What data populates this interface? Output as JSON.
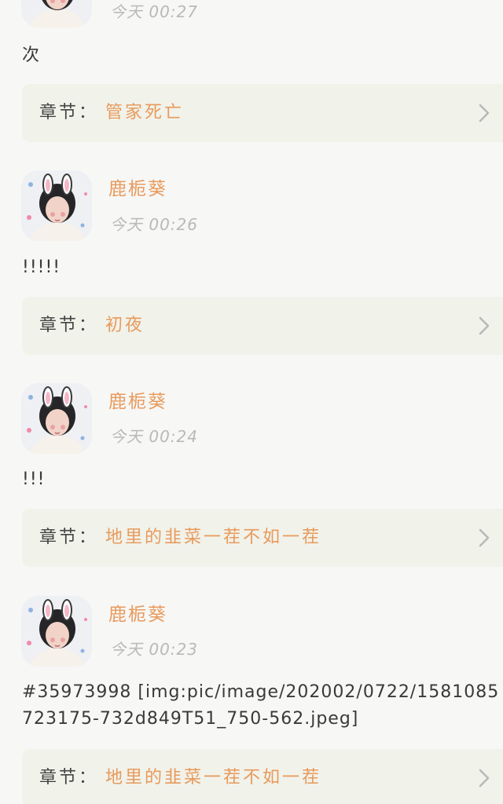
{
  "feed": {
    "entries": [
      {
        "username": "",
        "time": "今天 00:27",
        "content": "次",
        "chapter_prefix": "章节：",
        "chapter_title": "管家死亡"
      },
      {
        "username": "鹿栀葵",
        "time": "今天 00:26",
        "content": "!!!!!",
        "chapter_prefix": "章节：",
        "chapter_title": "初夜"
      },
      {
        "username": "鹿栀葵",
        "time": "今天 00:24",
        "content": "!!!",
        "chapter_prefix": "章节：",
        "chapter_title": "地里的韭菜一茬不如一茬"
      },
      {
        "username": "鹿栀葵",
        "time": "今天 00:23",
        "content": "#35973998 [img:pic/image/202002/0722/1581085723175-732d849T51_750-562.jpeg]",
        "chapter_prefix": "章节：",
        "chapter_title": "地里的韭菜一茬不如一茬"
      }
    ]
  },
  "icons": {
    "avatar": "user-avatar-image",
    "chevron": "chevron-right-icon"
  },
  "colors": {
    "accent": "#e89a5c",
    "card_bg": "#f1f2ea",
    "page_bg": "#f7f7f6",
    "muted": "#b9b9b9"
  }
}
